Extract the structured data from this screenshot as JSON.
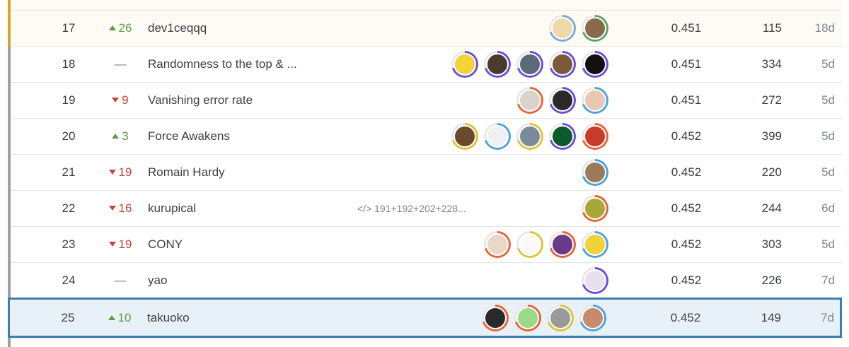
{
  "leaderboard": {
    "rows": [
      {
        "rank": "17",
        "change_dir": "up",
        "change": "26",
        "team": "dev1ceqqq",
        "code": "",
        "score": "0.451",
        "entries": "115",
        "last": "18d",
        "avatars": [
          {
            "ring": "#7aa9e0",
            "fill": "#f0d9a8"
          },
          {
            "ring": "#5aa46a",
            "fill": "#8a6a4a"
          }
        ]
      },
      {
        "rank": "18",
        "change_dir": "none",
        "change": "—",
        "team": "Randomness to the top & ...",
        "code": "",
        "score": "0.451",
        "entries": "334",
        "last": "5d",
        "avatars": [
          {
            "ring": "#6b4fd8",
            "fill": "#f2d43a"
          },
          {
            "ring": "#6b4fd8",
            "fill": "#4a3a30"
          },
          {
            "ring": "#6b4fd8",
            "fill": "#5a6a7a"
          },
          {
            "ring": "#6b4fd8",
            "fill": "#7a5a3a"
          },
          {
            "ring": "#6b4fd8",
            "fill": "#111111"
          }
        ]
      },
      {
        "rank": "19",
        "change_dir": "down",
        "change": "9",
        "team": "Vanishing error rate",
        "code": "",
        "score": "0.451",
        "entries": "272",
        "last": "5d",
        "avatars": [
          {
            "ring": "#e8643a",
            "fill": "#d8d4cc"
          },
          {
            "ring": "#6b4fd8",
            "fill": "#2a2a2a"
          },
          {
            "ring": "#4aa3e0",
            "fill": "#e8c8b0"
          }
        ]
      },
      {
        "rank": "20",
        "change_dir": "up",
        "change": "3",
        "team": "Force Awakens",
        "code": "",
        "score": "0.452",
        "entries": "399",
        "last": "5d",
        "avatars": [
          {
            "ring": "#e0c23a",
            "fill": "#6a4a2a"
          },
          {
            "ring": "#4aa3e0",
            "fill": "#f0f0f0"
          },
          {
            "ring": "#e0c23a",
            "fill": "#7a8a9a"
          },
          {
            "ring": "#6b4fd8",
            "fill": "#0a5a2a"
          },
          {
            "ring": "#e8643a",
            "fill": "#c83a2a"
          }
        ]
      },
      {
        "rank": "21",
        "change_dir": "down",
        "change": "19",
        "team": "Romain Hardy",
        "code": "",
        "score": "0.452",
        "entries": "220",
        "last": "5d",
        "avatars": [
          {
            "ring": "#4aa3e0",
            "fill": "#9a7a5a"
          }
        ]
      },
      {
        "rank": "22",
        "change_dir": "down",
        "change": "16",
        "team": "kurupical",
        "code": "</> 191+192+202+228...",
        "score": "0.452",
        "entries": "244",
        "last": "6d",
        "avatars": [
          {
            "ring": "#e8643a",
            "fill": "#a8a83a"
          }
        ]
      },
      {
        "rank": "23",
        "change_dir": "down",
        "change": "19",
        "team": "CONY",
        "code": "",
        "score": "0.452",
        "entries": "303",
        "last": "5d",
        "avatars": [
          {
            "ring": "#e8643a",
            "fill": "#e8d8c8"
          },
          {
            "ring": "#e0c23a",
            "fill": "#fafafa"
          },
          {
            "ring": "#e8643a",
            "fill": "#6a3a8a"
          },
          {
            "ring": "#4aa3e0",
            "fill": "#f2d23a"
          }
        ]
      },
      {
        "rank": "24",
        "change_dir": "none",
        "change": "—",
        "team": "yao",
        "code": "",
        "score": "0.452",
        "entries": "226",
        "last": "7d",
        "avatars": [
          {
            "ring": "#6b4fd8",
            "fill": "#e8e0f0"
          }
        ]
      },
      {
        "rank": "25",
        "change_dir": "up",
        "change": "10",
        "team": "takuoko",
        "code": "",
        "score": "0.452",
        "entries": "149",
        "last": "7d",
        "avatars": [
          {
            "ring": "#e8643a",
            "fill": "#2a2a2a"
          },
          {
            "ring": "#e8643a",
            "fill": "#9ad88a"
          },
          {
            "ring": "#e0c23a",
            "fill": "#9a9a9a"
          },
          {
            "ring": "#4aa3e0",
            "fill": "#c88a6a"
          }
        ]
      }
    ]
  }
}
